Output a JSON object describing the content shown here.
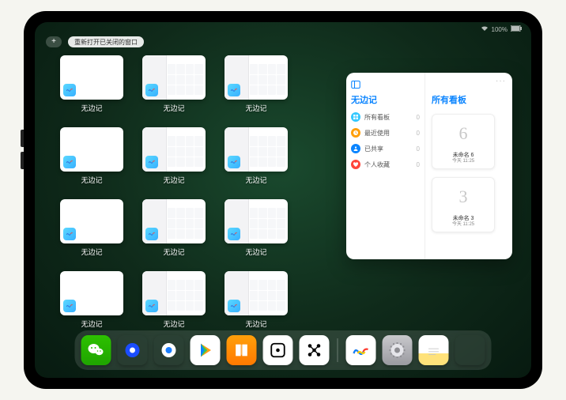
{
  "status": {
    "battery": "100%"
  },
  "topbar": {
    "add_label": "+",
    "reopen_label": "重新打开已关闭的窗口"
  },
  "app_switcher": {
    "app_label": "无边记",
    "icon_name": "freeform-icon",
    "windows": [
      {
        "style": "blank"
      },
      {
        "style": "split"
      },
      {
        "style": "split"
      },
      {
        "style": "blank"
      },
      {
        "style": "split"
      },
      {
        "style": "split"
      },
      {
        "style": "blank"
      },
      {
        "style": "split"
      },
      {
        "style": "split"
      },
      {
        "style": "blank"
      },
      {
        "style": "split"
      },
      {
        "style": "split"
      }
    ]
  },
  "popover": {
    "more": "···",
    "left_title": "无边记",
    "items": [
      {
        "icon": "grid",
        "color": "#34c8ff",
        "label": "所有看板",
        "count": 0
      },
      {
        "icon": "clock",
        "color": "#ff9f0a",
        "label": "最近使用",
        "count": 0
      },
      {
        "icon": "share",
        "color": "#0a84ff",
        "label": "已共享",
        "count": 0
      },
      {
        "icon": "heart",
        "color": "#ff453a",
        "label": "个人收藏",
        "count": 0
      }
    ],
    "right_title": "所有看板",
    "boards": [
      {
        "sketch": "6",
        "name": "未命名 6",
        "time": "今天 11:25"
      },
      {
        "sketch": "3",
        "name": "未命名 3",
        "time": "今天 11:25"
      }
    ]
  },
  "dock": {
    "apps": [
      {
        "name": "wechat"
      },
      {
        "name": "quark"
      },
      {
        "name": "qqbrowser"
      },
      {
        "name": "play"
      },
      {
        "name": "books"
      },
      {
        "name": "dice"
      },
      {
        "name": "node"
      }
    ],
    "recent": [
      {
        "name": "freeform"
      },
      {
        "name": "settings"
      },
      {
        "name": "notes"
      },
      {
        "name": "app-library"
      }
    ]
  }
}
